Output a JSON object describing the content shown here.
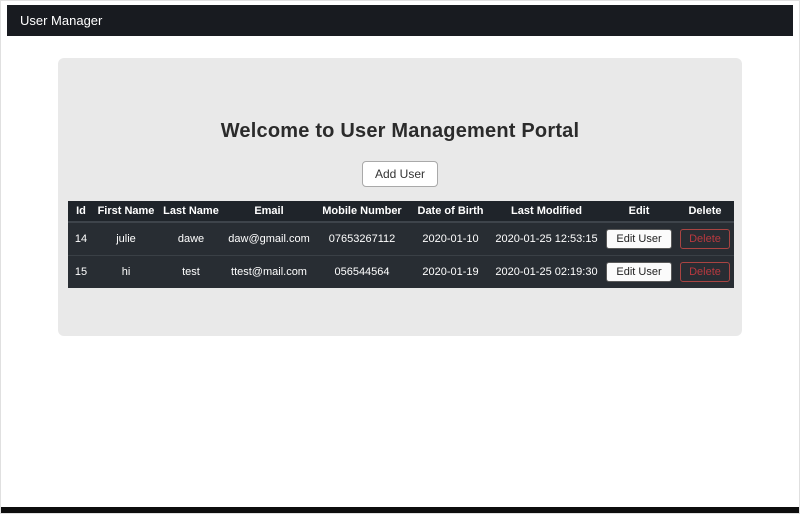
{
  "navbar": {
    "title": "User Manager"
  },
  "main": {
    "heading": "Welcome to User Management Portal",
    "add_user_label": "Add User"
  },
  "table": {
    "headers": [
      "Id",
      "First Name",
      "Last Name",
      "Email",
      "Mobile Number",
      "Date of Birth",
      "Last Modified",
      "Edit",
      "Delete"
    ],
    "edit_label": "Edit User",
    "delete_label": "Delete",
    "rows": [
      {
        "id": "14",
        "first_name": "julie",
        "last_name": "dawe",
        "email": "daw@gmail.com",
        "mobile": "07653267112",
        "dob": "2020-01-10",
        "modified": "2020-01-25 12:53:15"
      },
      {
        "id": "15",
        "first_name": "hi",
        "last_name": "test",
        "email": "ttest@mail.com",
        "mobile": "056544564",
        "dob": "2020-01-19",
        "modified": "2020-01-25 02:19:30"
      }
    ]
  },
  "colors": {
    "navbar_bg": "#181b20",
    "card_bg": "#e9e9e9",
    "table_bg": "#282d33",
    "danger": "#a94442"
  }
}
